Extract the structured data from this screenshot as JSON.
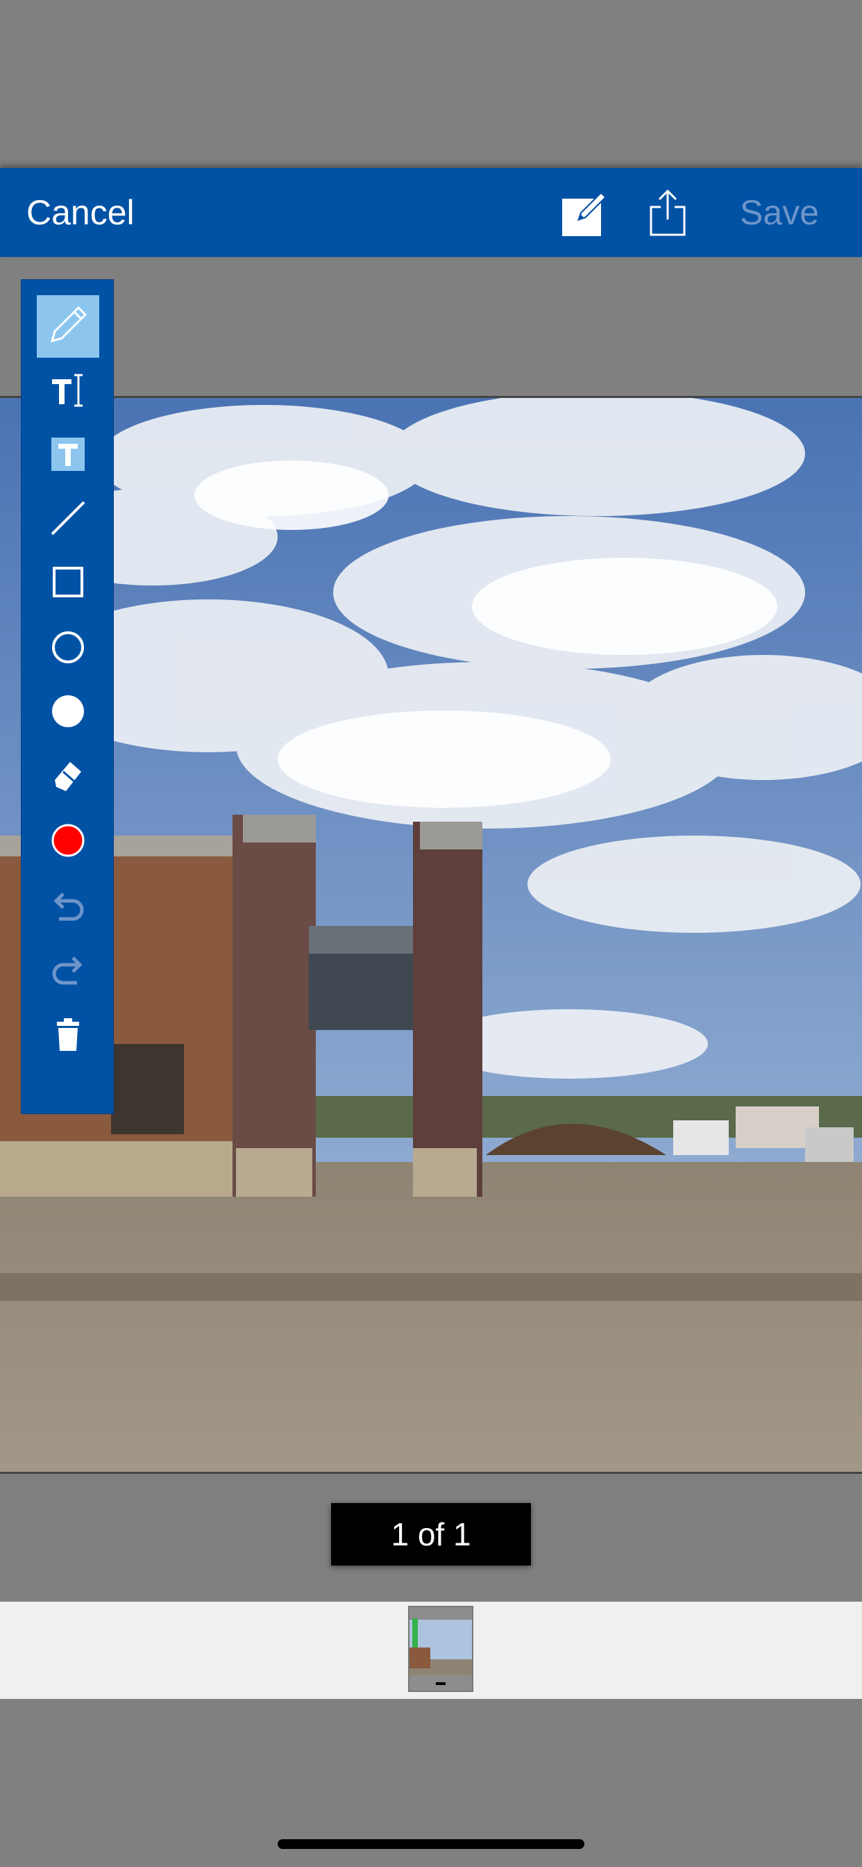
{
  "navbar": {
    "cancel_label": "Cancel",
    "save_label": "Save",
    "icons": [
      "edit-icon",
      "share-icon"
    ]
  },
  "toolbar": {
    "tools": [
      {
        "name": "pencil-tool",
        "icon": "pencil-icon",
        "selected": true
      },
      {
        "name": "text-tool",
        "icon": "text-cursor-icon"
      },
      {
        "name": "text-box-tool",
        "icon": "text-box-icon"
      },
      {
        "name": "line-tool",
        "icon": "line-icon"
      },
      {
        "name": "rectangle-tool",
        "icon": "square-outline-icon"
      },
      {
        "name": "ellipse-tool",
        "icon": "circle-outline-icon"
      },
      {
        "name": "filled-ellipse-tool",
        "icon": "circle-filled-icon"
      },
      {
        "name": "eraser-tool",
        "icon": "eraser-icon"
      },
      {
        "name": "color-picker",
        "icon": "color-circle-icon",
        "color": "#ff0000"
      },
      {
        "name": "undo-button",
        "icon": "undo-icon"
      },
      {
        "name": "redo-button",
        "icon": "redo-icon"
      },
      {
        "name": "delete-button",
        "icon": "trash-icon"
      }
    ]
  },
  "pager": {
    "page_label": "1 of 1"
  },
  "colors": {
    "navbar": "#0152a5",
    "save_disabled": "#6f95c9",
    "tool_selected": "#8cc6ef",
    "background": "#808080"
  }
}
